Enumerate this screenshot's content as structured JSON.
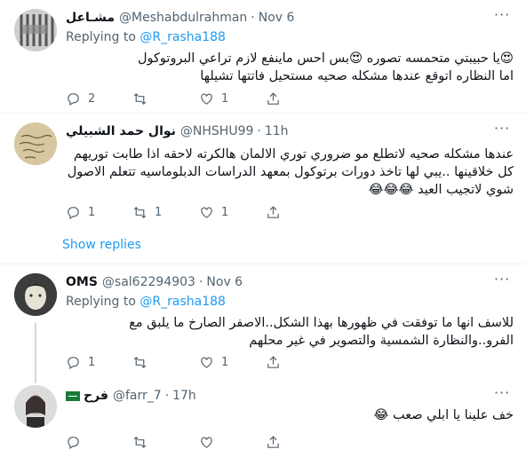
{
  "tweets": [
    {
      "name": "مشـاعل",
      "handle": "@Meshabdulrahman",
      "time": "Nov 6",
      "replying_label": "Replying to",
      "replying_to": "@R_rasha188",
      "lines": [
        "😍يا حبيبتي متحمسه تصوره 😍بس احس ماينفع لازم تراعي البروتوكول",
        "اما النظاره اتوقع عندها مشكله صحيه مستحيل فاتتها تشيلها"
      ],
      "replies": "2",
      "retweets": "",
      "likes": "1"
    },
    {
      "name": "نوال حمد الشبيلي",
      "handle": "@NHSHU99",
      "time": "11h",
      "lines": [
        "عندها مشكله صحيه لاتطلع مو ضروري توري الالمان هالكرته لاحقه اذا طابت توريهم",
        "كل خلاقينها ..يبي لها تاخذ دورات برتوكول بمعهد الدراسات الدبلوماسيه تتعلم الاصول",
        "شوي لاتجيب العيد 😂😂😂"
      ],
      "replies": "1",
      "retweets": "1",
      "likes": "1",
      "show_replies": "Show replies"
    },
    {
      "name": "OMS",
      "handle": "@sal62294903",
      "time": "Nov 6",
      "replying_label": "Replying to",
      "replying_to": "@R_rasha188",
      "lines": [
        "للاسف انها ما توفقت في ظهورها بهذا الشكل..الاصفر الصارخ ما يلبق مع",
        "الفرو..والنظارة الشمسية والتصوير في غير محلهم"
      ],
      "replies": "1",
      "retweets": "",
      "likes": "1"
    },
    {
      "name": "فرح",
      "handle": "@farr_7",
      "time": "17h",
      "lines": [
        "خف علينا يا ابلي صعب 😂"
      ],
      "replies": "",
      "retweets": "",
      "likes": ""
    }
  ],
  "icons": {
    "reply": "reply-icon",
    "retweet": "retweet-icon",
    "like": "heart-icon",
    "share": "share-icon",
    "menu": "more-icon",
    "flag": "saudi-flag-icon"
  },
  "colors": {
    "link": "#1d9bf0",
    "secondary": "#536471",
    "separator": "#eff3f4"
  }
}
